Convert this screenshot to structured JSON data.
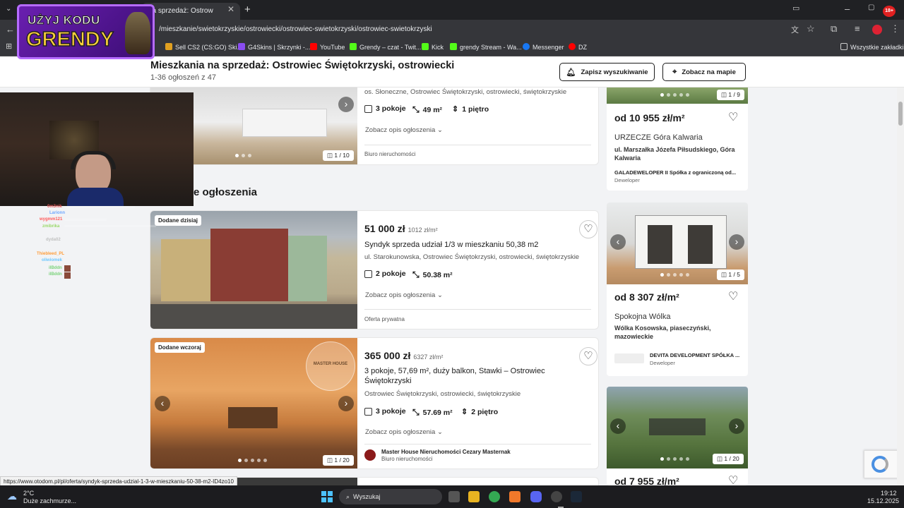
{
  "browser": {
    "tab_title": "na sprzedaż: Ostrow",
    "url": "/mieszkanie/swietokrzyskie/ostrowiecki/ostrowiec-swietokrzyski/ostrowiec-swietokrzyski",
    "bookmarks": [
      "Sell CS2 (CS:GO) Ski...",
      "G4Skins | Skrzynki -...",
      "YouTube",
      "Grendy – czat - Twit...",
      "Kick",
      "grendy Stream - Wa...",
      "Messenger",
      "DZ"
    ],
    "all_bookmarks": "Wszystkie zakładki",
    "status_url": "https://www.otodom.pl/pl/oferta/syndyk-sprzeda-udzial-1-3-w-mieszkaniu-50-38-m2-ID4zo10"
  },
  "overlay": {
    "promo_line1": "UŻYJ KODU",
    "promo_line2": "GRENDY",
    "chat_users": [
      "0m3nik",
      "Larionn",
      "wygmm121",
      "zmibrika",
      "dyda02",
      "Thiebleed_PL",
      "oliwiomek",
      "ilBddn",
      "ilBddn"
    ],
    "chat_colors": [
      "#e05555",
      "#6fa8ff",
      "#ff5a5a",
      "#9ad96a",
      "#c0c0c0",
      "#ff9d3a",
      "#6ec8ff",
      "#7bd37b",
      "#7bd37b"
    ]
  },
  "page": {
    "title": "Mieszkania na sprzedaż: Ostrowiec Świętokrzyski, ostrowiecki",
    "count": "1-36 ogłoszeń z 47",
    "save_search": "Zapisz wyszukiwanie",
    "map_view": "Zobacz na mapie",
    "section_heading": "e ogłoszenia"
  },
  "listings": [
    {
      "address": "os. Słoneczne, Ostrowiec Świętokrzyski, ostrowiecki, świętokrzyskie",
      "rooms": "3 pokoje",
      "area": "49 m²",
      "floor": "1 piętro",
      "more": "Zobacz opis ogłoszenia",
      "seller_type": "Biuro nieruchomości",
      "photo_counter": "1 / 10"
    },
    {
      "badge": "Dodane dzisiaj",
      "price": "51 000 zł",
      "price_per_m": "1012 zł/m²",
      "title": "Syndyk sprzeda udział 1/3 w mieszkaniu 50,38 m2",
      "address": "ul. Starokunowska, Ostrowiec Świętokrzyski, ostrowiecki, świętokrzyskie",
      "rooms": "2 pokoje",
      "area": "50.38 m²",
      "more": "Zobacz opis ogłoszenia",
      "seller_type": "Oferta prywatna"
    },
    {
      "badge": "Dodane wczoraj",
      "price": "365 000 zł",
      "price_per_m": "6327 zł/m²",
      "title": "3 pokoje, 57,69 m², duży balkon, Stawki – Ostrowiec Świętokrzyski",
      "address": "Ostrowiec Świętokrzyski, ostrowiecki, świętokrzyskie",
      "rooms": "3 pokoje",
      "area": "57.69 m²",
      "floor": "2 piętro",
      "more": "Zobacz opis ogłoszenia",
      "agency": "Master House Nieruchomości Cezary Masternak",
      "seller_type": "Biuro nieruchomości",
      "photo_counter": "1 / 20",
      "watermark": "MASTER HOUSE"
    }
  ],
  "ads": [
    {
      "counter": "1 / 9",
      "price": "od 10 955 zł/m²",
      "name": "URZECZE Góra Kalwaria",
      "location": "ul. Marszałka Józefa Piłsudskiego, Góra Kalwaria",
      "developer": "GALADEWELOPER II Spółka z ograniczoną od...",
      "type": "Deweloper"
    },
    {
      "counter": "1 / 5",
      "price": "od 8 307 zł/m²",
      "name": "Spokojna Wólka",
      "location": "Wólka Kosowska, piaseczyński, mazowieckie",
      "developer": "DEVITA DEVELOPMENT SPÓŁKA ...",
      "type": "Deweloper"
    },
    {
      "counter": "1 / 20",
      "price": "od 7 955 zł/m²"
    }
  ],
  "taskbar": {
    "temp": "2°C",
    "weather": "Duże zachmurze...",
    "search": "Wyszukaj",
    "time": "19:12",
    "date": "15.12.2025"
  }
}
